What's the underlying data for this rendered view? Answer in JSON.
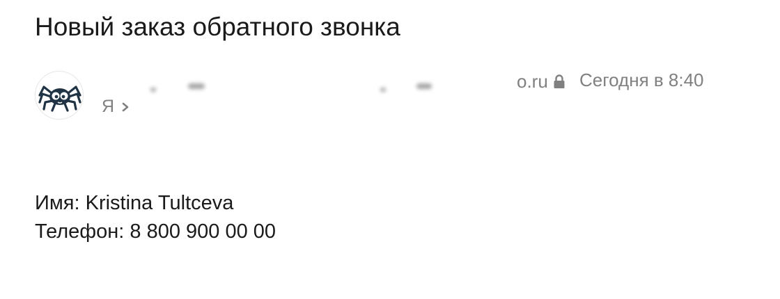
{
  "email": {
    "subject": "Новый заказ обратного звонка",
    "sender": {
      "avatar_icon": "spider-logo-icon",
      "domain_visible": "o.ru",
      "lock_icon": "lock-icon"
    },
    "date": "Сегодня в 8:40",
    "recipient": {
      "label": "Я",
      "chevron_icon": "chevron-right-icon"
    },
    "body": {
      "name_line": "Имя: Kristina Tultceva",
      "phone_line": "Телефон: 8 800 900 00 00"
    }
  },
  "colors": {
    "text_primary": "#1a1a1a",
    "text_secondary": "#808080",
    "logo_dark": "#1f3344"
  }
}
